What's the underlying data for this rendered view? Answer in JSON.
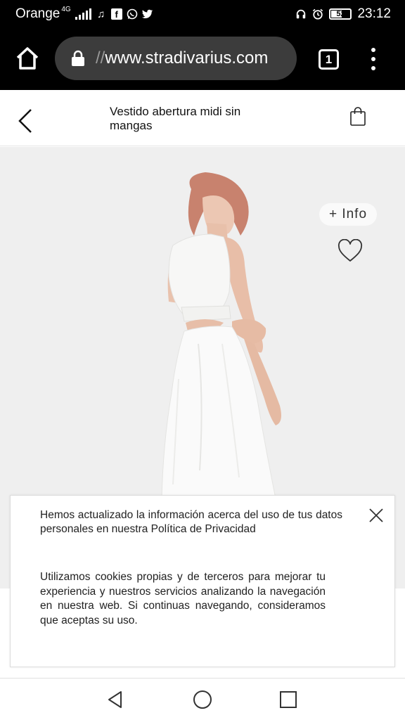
{
  "status_bar": {
    "carrier": "Orange",
    "network": "4G",
    "icons": [
      "signal-icon",
      "music-icon",
      "facebook-icon",
      "whatsapp-icon",
      "twitter-icon",
      "headset-icon",
      "alarm-icon",
      "battery-icon"
    ],
    "battery": "52",
    "time": "23:12"
  },
  "browser": {
    "url_prefix": "//",
    "url_host": "www.stradivarius.com",
    "tab_count": "1"
  },
  "header": {
    "title": "Vestido abertura midi sin mangas"
  },
  "product": {
    "info_label": "+ Info"
  },
  "cookie_banner": {
    "text1": "Hemos actualizado la información acerca del uso de tus datos personales en nuestra Política de Privacidad",
    "text2": "Utilizamos cookies propias y de terceros para mejorar tu experiencia y nuestros servicios analizando la navegación en nuestra web. Si continuas navegando, consideramos que aceptas su uso."
  },
  "colors": {
    "status_bg": "#000000",
    "url_pill": "#3c3c3c",
    "product_bg": "#efefef",
    "text": "#222222"
  }
}
